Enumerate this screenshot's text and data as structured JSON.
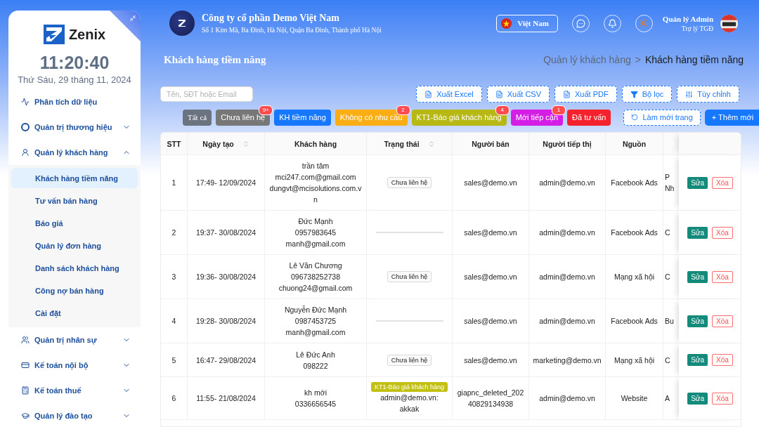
{
  "sidebar": {
    "logo": "Zenix",
    "clock": "11:20:40",
    "date": "Thứ Sáu, 29 tháng 11, 2024",
    "menu": [
      {
        "kind": "link",
        "label": "Phân tích dữ liệu"
      },
      {
        "kind": "group",
        "label": "Quản trị thương hiệu",
        "expanded": false
      },
      {
        "kind": "group",
        "label": "Quản lý khách hàng",
        "expanded": true,
        "children": [
          {
            "label": "Khách hàng tiềm năng",
            "selected": true
          },
          {
            "label": "Tư vấn bán hàng",
            "selected": false
          },
          {
            "label": "Báo giá",
            "selected": false
          },
          {
            "label": "Quản lý đơn hàng",
            "selected": false
          },
          {
            "label": "Danh sách khách hàng",
            "selected": false
          },
          {
            "label": "Công nợ bán hàng",
            "selected": false
          },
          {
            "label": "Cài đặt",
            "selected": false
          }
        ]
      },
      {
        "kind": "group",
        "label": "Quản trị nhân sự",
        "expanded": false
      },
      {
        "kind": "group",
        "label": "Kế toán nội bộ",
        "expanded": false
      },
      {
        "kind": "group",
        "label": "Kế toán thuế",
        "expanded": false
      },
      {
        "kind": "group",
        "label": "Quản lý đào tạo",
        "expanded": false
      }
    ]
  },
  "header": {
    "company": "Công ty cổ phần Demo Việt Nam",
    "address": "Số 1 Kim Mã, Ba Đình, Hà Nội, Quận Ba Đình, Thành phố Hà Nội",
    "language": "Việt Nam",
    "user_name": "Quản lý Admin",
    "user_role": "Trợ lý TGĐ"
  },
  "page": {
    "title": "Khách hàng tiềm năng",
    "breadcrumb": [
      "Quản lý khách hàng",
      "Khách hàng tiềm năng"
    ],
    "separator": ">"
  },
  "search": {
    "placeholder": "Tên, SĐT hoặc Email"
  },
  "tool_buttons": [
    {
      "kind": "file",
      "label": "Xuất Excel"
    },
    {
      "kind": "file",
      "label": "Xuất CSV"
    },
    {
      "kind": "file",
      "label": "Xuất PDF"
    },
    {
      "kind": "filter",
      "label": "Bộ lọc"
    },
    {
      "kind": "columns",
      "label": "Tùy chỉnh"
    }
  ],
  "status_chips": [
    {
      "label": "Tất cả",
      "color": "#6b7280"
    },
    {
      "label": "Chưa liên hệ",
      "color": "#777777",
      "badge": "9+"
    },
    {
      "label": "KH tiềm năng",
      "color": "#1677ff"
    },
    {
      "label": "Không có nhu cầu",
      "color": "#faad14",
      "badge": "2"
    },
    {
      "label": "KT1-Báo giá khách hàng",
      "color": "#b8b814",
      "badge": "4"
    },
    {
      "label": "Mới tiếp cận",
      "color": "#d41ee6",
      "badge": "1"
    },
    {
      "label": "Đã tư vấn",
      "color": "#f5222d"
    }
  ],
  "actions": [
    {
      "kind": "refresh",
      "label": "Làm mới trang"
    },
    {
      "kind": "add",
      "label": "+ Thêm mới"
    }
  ],
  "table": {
    "columns": [
      {
        "label": "STT",
        "sortable": false
      },
      {
        "label": "Ngày tạo",
        "sortable": true
      },
      {
        "label": "Khách hàng",
        "sortable": false
      },
      {
        "label": "Trạng thái",
        "sortable": true
      },
      {
        "label": "Người bán",
        "sortable": false
      },
      {
        "label": "Người tiếp thị",
        "sortable": false
      },
      {
        "label": "Nguồn",
        "sortable": false
      }
    ],
    "rows": [
      {
        "stt": "1",
        "created": "17:49- 12/09/2024",
        "customer": [
          "trần tâm",
          "mci247.com@gmail.com",
          "dungvt@mcisolutions.com.vn"
        ],
        "status": {
          "kind": "tag",
          "label": "Chưa liên hệ"
        },
        "seller": "sales@demo.vn",
        "marketer": "admin@demo.vn",
        "source": "Facebook Ads",
        "column_8": [
          "P",
          "Nh"
        ],
        "edit": "Sửa",
        "delete": "Xóa"
      },
      {
        "stt": "2",
        "created": "19:37- 30/08/2024",
        "customer": [
          "Đức Mạnh",
          "0957983645",
          "manh@gmail.com"
        ],
        "status": {
          "kind": "empty"
        },
        "seller": "sales@demo.vn",
        "marketer": "admin@demo.vn",
        "source": "Facebook Ads",
        "column_8": [
          "C"
        ],
        "edit": "Sửa",
        "delete": "Xóa"
      },
      {
        "stt": "3",
        "created": "19:36- 30/08/2024",
        "customer": [
          "Lê Văn Chương",
          "096738252738",
          "chuong24@gmail.com"
        ],
        "status": {
          "kind": "tag",
          "label": "Chưa liên hệ"
        },
        "seller": "sales@demo.vn",
        "marketer": "admin@demo.vn",
        "source": "Mạng xã hội",
        "column_8": [
          "C"
        ],
        "edit": "Sửa",
        "delete": "Xóa"
      },
      {
        "stt": "4",
        "created": "19:28- 30/08/2024",
        "customer": [
          "Nguyễn Đức Mạnh",
          "0987453725",
          "manh@gmail.com"
        ],
        "status": {
          "kind": "empty"
        },
        "seller": "sales@demo.vn",
        "marketer": "admin@demo.vn",
        "source": "Facebook Ads",
        "column_8": [
          "Bu"
        ],
        "edit": "Sửa",
        "delete": "Xóa"
      },
      {
        "stt": "5",
        "created": "16:47- 29/08/2024",
        "customer": [
          "Lê Đức Anh",
          "098222"
        ],
        "status": {
          "kind": "tag",
          "label": "Chưa liên hệ"
        },
        "seller": "sales@demo.vn",
        "marketer": "marketing@demo.vn",
        "source": "Mạng xã hội",
        "column_8": [
          "C"
        ],
        "edit": "Sửa",
        "delete": "Xóa"
      },
      {
        "stt": "6",
        "created": "11:55- 21/08/2024",
        "customer": [
          "kh mới",
          "0336656545"
        ],
        "status": {
          "kind": "highlight",
          "label": "KT1-Báo giá khách hàng",
          "note": "admin@demo.vn: akkak"
        },
        "seller": "giapnc_deleted_20240829134938",
        "marketer": "admin@demo.vn",
        "source": "Website",
        "column_8": [
          "A"
        ],
        "edit": "Sửa",
        "delete": "Xóa"
      }
    ]
  }
}
